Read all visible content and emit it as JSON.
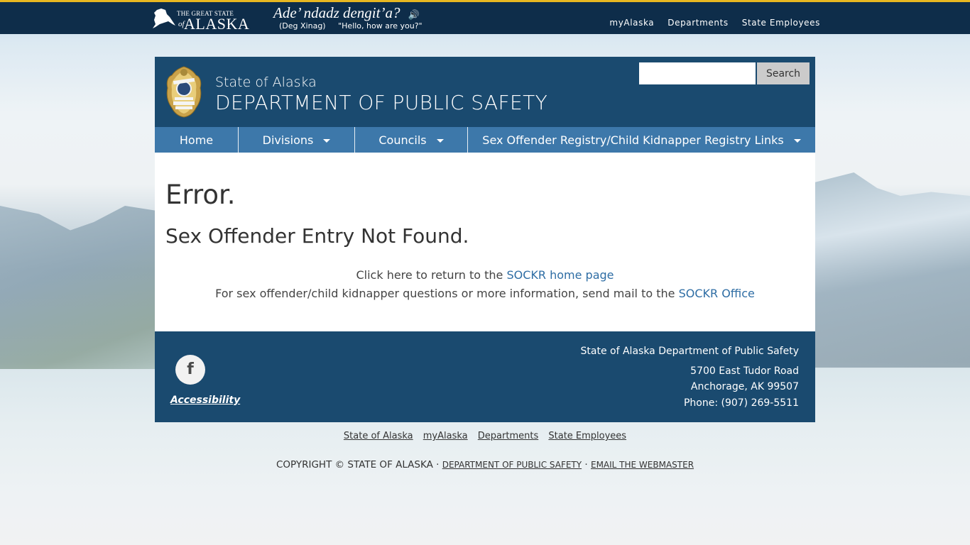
{
  "topbar": {
    "logo": {
      "line1": "THE GREAT STATE",
      "of": "of",
      "alaska": "ALASKA",
      "map_glyph": "✈"
    },
    "greeting": {
      "native": "Ade’ ndadz dengit’a?",
      "speaker_icon": "🔊",
      "language": "(Deg Xinag)",
      "translation": "\"Hello, how are you?\""
    },
    "links": [
      "myAlaska",
      "Departments",
      "State Employees"
    ]
  },
  "header": {
    "small_title": "State of Alaska",
    "big_title": "DEPARTMENT OF PUBLIC SAFETY",
    "search": {
      "placeholder": "",
      "value": "",
      "button": "Search"
    }
  },
  "nav": {
    "items": [
      {
        "label": "Home",
        "dropdown": false
      },
      {
        "label": "Divisions",
        "dropdown": true
      },
      {
        "label": "Councils",
        "dropdown": true
      },
      {
        "label": "Sex Offender Registry/Child Kidnapper Registry Links",
        "dropdown": true
      }
    ]
  },
  "main": {
    "title": "Error.",
    "subtitle": "Sex Offender Entry Not Found.",
    "line1_prefix": "Click here to return to the ",
    "line1_link": "SOCKR home page",
    "line2_prefix": "For sex offender/child kidnapper questions or more information, send mail to the ",
    "line2_link": "SOCKR Office"
  },
  "footer": {
    "facebook_glyph": "f",
    "accessibility": "Accessibility",
    "org": "State of Alaska Department of Public Safety",
    "street": "5700 East Tudor Road",
    "city": "Anchorage, AK 99507",
    "phone": "Phone: (907) 269-5511"
  },
  "bottom_links": [
    "State of Alaska",
    "myAlaska",
    "Departments",
    "State Employees"
  ],
  "copyright": {
    "prefix": "COPYRIGHT © STATE OF ALASKA · ",
    "link1": "DEPARTMENT OF PUBLIC SAFETY",
    "sep": " · ",
    "link2": "EMAIL THE WEBMASTER"
  },
  "colors": {
    "topbar_bg": "#0e2d4a",
    "topbar_accent": "#e7b721",
    "header_bg": "#1a4a6f",
    "nav_bg": "#3d78aa",
    "link": "#2e6da4"
  }
}
